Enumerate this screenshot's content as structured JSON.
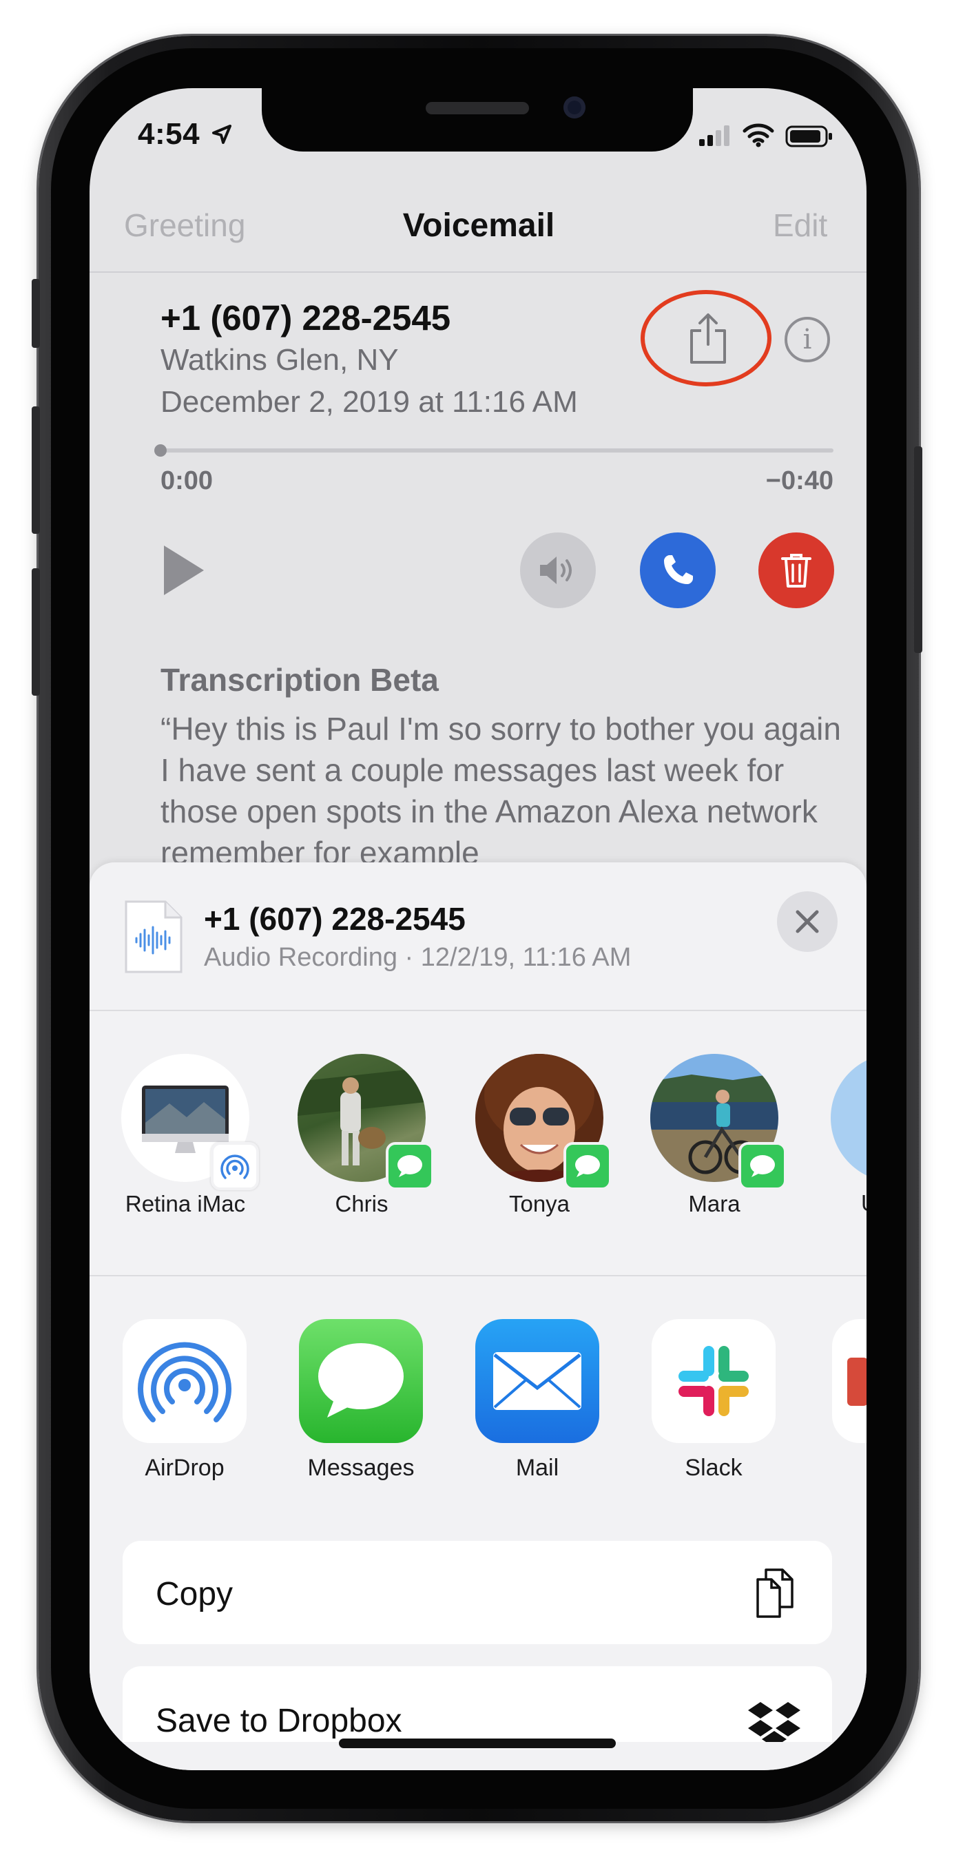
{
  "status_bar": {
    "time": "4:54"
  },
  "nav": {
    "left": "Greeting",
    "title": "Voicemail",
    "right": "Edit"
  },
  "voicemail": {
    "number": "+1 (607) 228-2545",
    "location": "Watkins Glen, NY",
    "date": "December 2, 2019 at 11:16 AM",
    "elapsed": "0:00",
    "remaining": "−0:40",
    "progress": 0,
    "transcription_title": "Transcription Beta",
    "transcription_text": "“Hey this is Paul I'm so sorry to bother you again I have sent a couple messages last week for those open spots in the Amazon Alexa network remember for example"
  },
  "share_sheet": {
    "title": "+1 (607) 228-2545",
    "subtitle": "Audio Recording · 12/2/19, 11:16 AM",
    "people": [
      {
        "name": "Retina iMac",
        "badge": "airdrop-icon"
      },
      {
        "name": "Chris",
        "badge": "messages-icon"
      },
      {
        "name": "Tonya",
        "badge": "messages-icon"
      },
      {
        "name": "Mara",
        "badge": "messages-icon"
      },
      {
        "name": "U",
        "badge": ""
      }
    ],
    "apps": [
      {
        "name": "AirDrop",
        "icon": "airdrop-icon"
      },
      {
        "name": "Messages",
        "icon": "messages-icon"
      },
      {
        "name": "Mail",
        "icon": "mail-icon"
      },
      {
        "name": "Slack",
        "icon": "slack-icon"
      }
    ],
    "actions": [
      {
        "label": "Copy",
        "icon": "copy-icon"
      },
      {
        "label": "Save to Dropbox",
        "icon": "dropbox-icon"
      }
    ]
  },
  "colors": {
    "highlight_ring": "#e23c1f",
    "call": "#2d6ad9",
    "delete": "#d8382c",
    "messages_green": "#34c759"
  }
}
